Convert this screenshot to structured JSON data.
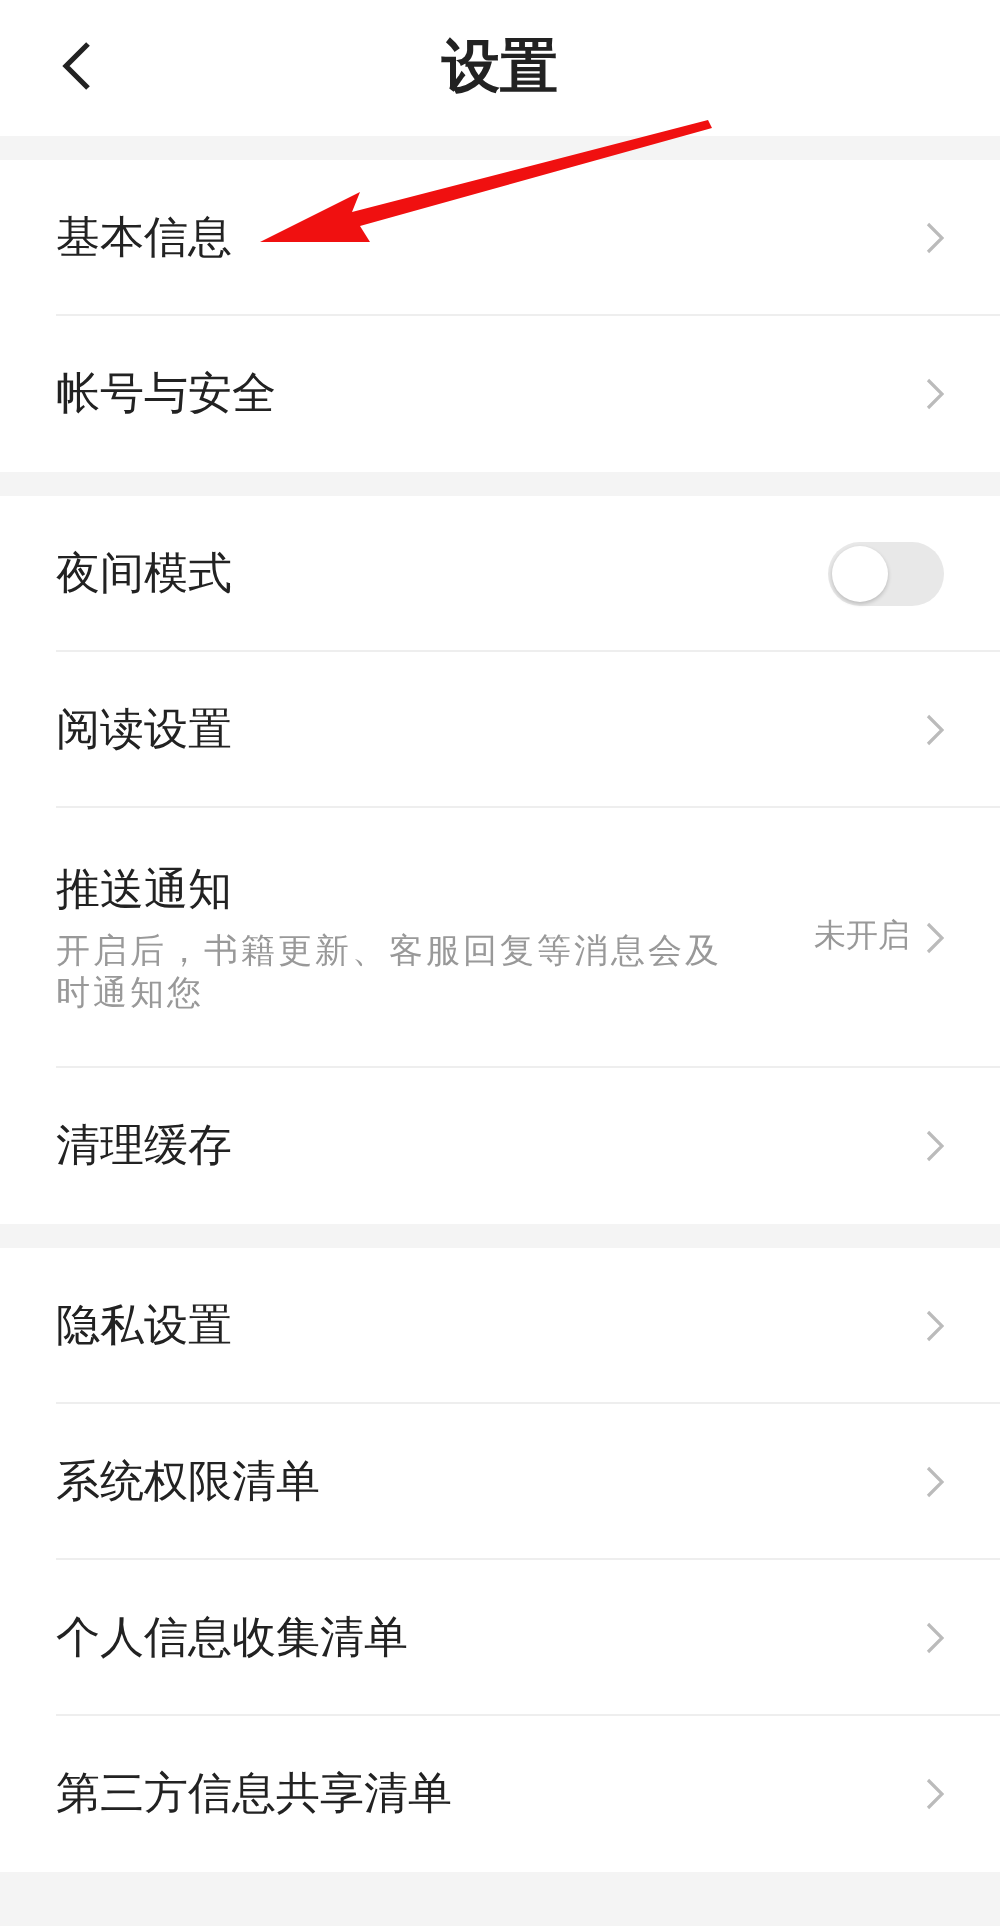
{
  "header": {
    "title": "设置"
  },
  "groups": [
    {
      "items": [
        {
          "kind": "link",
          "label": "基本信息"
        },
        {
          "kind": "link",
          "label": "帐号与安全"
        }
      ]
    },
    {
      "items": [
        {
          "kind": "toggle",
          "label": "夜间模式",
          "on": false
        },
        {
          "kind": "link",
          "label": "阅读设置"
        },
        {
          "kind": "link",
          "label": "推送通知",
          "description": "开启后，书籍更新、客服回复等消息会及时通知您",
          "value": "未开启"
        },
        {
          "kind": "link",
          "label": "清理缓存"
        }
      ]
    },
    {
      "items": [
        {
          "kind": "link",
          "label": "隐私设置"
        },
        {
          "kind": "link",
          "label": "系统权限清单"
        },
        {
          "kind": "link",
          "label": "个人信息收集清单"
        },
        {
          "kind": "link",
          "label": "第三方信息共享清单"
        }
      ]
    }
  ]
}
